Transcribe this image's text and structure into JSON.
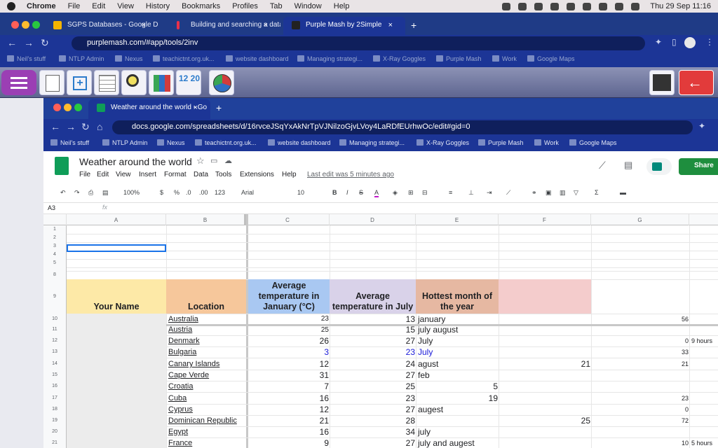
{
  "menubar": {
    "app": "Chrome",
    "items": [
      "File",
      "Edit",
      "View",
      "History",
      "Bookmarks",
      "Profiles",
      "Tab",
      "Window",
      "Help"
    ],
    "clock": "Thu 29 Sep  11:16"
  },
  "outer_browser": {
    "tabs": [
      "SGPS Databases - Google Drive",
      "Building and searching a datab",
      "Purple Mash by 2Simple"
    ],
    "url": "purplemash.com/#app/tools/2inv",
    "bookmarks": [
      "Neil's stuff",
      "NTLP Admin",
      "Nexus",
      "teachictnt.org.uk...",
      "website dashboard",
      "Managing strategi...",
      "X-Ray Goggles",
      "Purple Mash",
      "Work",
      "Google Maps"
    ]
  },
  "inner_browser": {
    "tab": "Weather around the world - Go",
    "url": "docs.google.com/spreadsheets/d/16rvceJSqYxAkNrTpVJNilzoGjvLVoy4LaRDfEUrhwOc/edit#gid=0",
    "bookmarks": [
      "Neil's stuff",
      "NTLP Admin",
      "Nexus",
      "teachictnt.org.uk...",
      "website dashboard",
      "Managing strategi...",
      "X-Ray Goggles",
      "Purple Mash",
      "Work",
      "Google Maps"
    ]
  },
  "sheet": {
    "title": "Weather around the world",
    "menus": [
      "File",
      "Edit",
      "View",
      "Insert",
      "Format",
      "Data",
      "Tools",
      "Extensions",
      "Help"
    ],
    "last_edit": "Last edit was 5 minutes ago",
    "share": "Share",
    "toolbar": {
      "zoom": "100%",
      "currency": "$",
      "percent": "%",
      "dec_less": ".0",
      "dec_more": ".00",
      "format": "123",
      "font": "Arial",
      "size": "10"
    },
    "name_box": "A3",
    "fx": "fx",
    "columns": [
      "A",
      "B",
      "C",
      "D",
      "E",
      "F",
      "G"
    ],
    "row_numbers": [
      "1",
      "2",
      "3",
      "4",
      "5",
      "",
      "8",
      "9",
      "10",
      "11",
      "12",
      "13",
      "14",
      "15",
      "16",
      "17",
      "18",
      "19",
      "20",
      "21"
    ],
    "headers": {
      "name": "Your Name",
      "location": "Location",
      "jan": "Average temperature in January (°C)",
      "jul": "Average temperature in July",
      "hot": "Hottest month of the year"
    },
    "rows": [
      {
        "loc": "Australia",
        "c": "23",
        "d": "13",
        "e": "january",
        "f": "",
        "g": "56",
        "h": ""
      },
      {
        "loc": "Austria",
        "c": "25",
        "d": "15",
        "e": "july august",
        "f": "",
        "g": "",
        "h": ""
      },
      {
        "loc": "Denmark",
        "c": "26",
        "d": "27",
        "e": "July",
        "f": "",
        "g": "0",
        "h": "9 hours"
      },
      {
        "loc": "Bulgaria",
        "c": "3",
        "d": "23",
        "e": "July",
        "f": "",
        "g": "33",
        "h": ""
      },
      {
        "loc": "Canary Islands",
        "c": "12",
        "d": "24",
        "e": "agust",
        "f": "21",
        "g": "21",
        "h": ""
      },
      {
        "loc": "Cape Verde",
        "c": "31",
        "d": "27",
        "e": "feb",
        "f": "",
        "g": "",
        "h": ""
      },
      {
        "loc": "Croatia",
        "c": "7",
        "d": "25",
        "e": "5",
        "f": "",
        "g": "",
        "h": ""
      },
      {
        "loc": "Cuba",
        "c": "16",
        "d": "23",
        "e": "19",
        "f": "",
        "g": "23",
        "h": ""
      },
      {
        "loc": "Cyprus",
        "c": "12",
        "d": "27",
        "e": "augest",
        "f": "",
        "g": "0",
        "h": ""
      },
      {
        "loc": "Dominican Republic",
        "c": "21",
        "d": "28",
        "e": "",
        "f": "25",
        "g": "72",
        "h": ""
      },
      {
        "loc": "Egypt",
        "c": "16",
        "d": "34",
        "e": "july",
        "f": "",
        "g": "",
        "h": ""
      },
      {
        "loc": "France",
        "c": "9",
        "d": "27",
        "e": "july and augest",
        "f": "",
        "g": "10",
        "h": "5 hours"
      }
    ]
  }
}
